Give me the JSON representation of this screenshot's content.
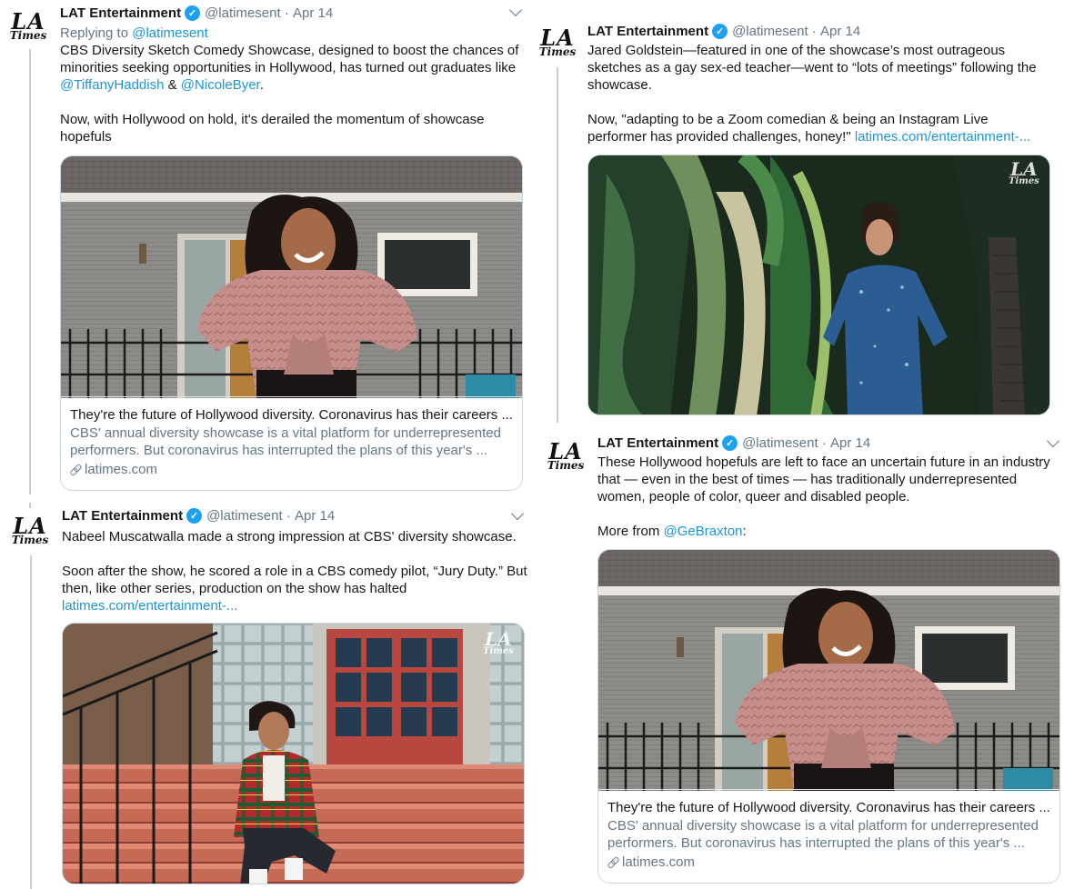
{
  "account": {
    "name": "LAT Entertainment",
    "handle": "@latimesent",
    "date": "Apr 14",
    "avatar_top": "LA",
    "avatar_bottom": "Times",
    "verified_icon": "verified-badge-icon",
    "brand_color": "#1da1f2"
  },
  "tweet1": {
    "replying_prefix": "Replying to ",
    "replying_handle": "@latimesent",
    "line1": "CBS Diversity Sketch Comedy Showcase, designed to boost the chances of",
    "line2": "minorities seeking opportunities in Hollywood, has turned out graduates like",
    "mention1": "@TiffanyHaddish",
    "amp": " & ",
    "mention2": "@NicoleByer",
    "dot": ".",
    "line4": "Now, with Hollywood on hold, it's derailed the momentum of showcase",
    "line5": "hopefuls",
    "card": {
      "title": "They're the future of Hollywood diversity. Coronavirus has their careers ...",
      "desc1": "CBS' annual diversity showcase is a vital platform for underrepresented",
      "desc2": "performers. But coronavirus has interrupted the plans of this year's ...",
      "domain": "latimes.com"
    }
  },
  "tweet2": {
    "line1": "Jared Goldstein—featured in one of the showcase’s most outrageous",
    "line2": "sketches as a gay sex-ed teacher—went to “lots of meetings” following the",
    "line3": "showcase.",
    "line4": "Now, \"adapting to be a Zoom comedian & being an Instagram Live",
    "line5a": "performer has provided challenges, honey!\" ",
    "line5link": "latimes.com/entertainment-..."
  },
  "tweet3": {
    "line1": "Nabeel Muscatwalla made a strong impression at CBS' diversity showcase.",
    "line2": "Soon after the show, he scored a role in a CBS comedy pilot, “Jury Duty.” But",
    "line3": "then, like other series, production on the show has halted",
    "link": "latimes.com/entertainment-..."
  },
  "tweet4": {
    "line1": "These Hollywood hopefuls are left to face an uncertain future in an industry",
    "line2": "that — even in the best of times — has traditionally underrepresented",
    "line3": "women, people of color, queer and disabled people.",
    "more_prefix": "More from ",
    "mention": "@GeBraxton",
    "colon": ":",
    "card": {
      "title": "They're the future of Hollywood diversity. Coronavirus has their careers ...",
      "desc1": "CBS' annual diversity showcase is a vital platform for underrepresented",
      "desc2": "performers. But coronavirus has interrupted the plans of this year's ...",
      "domain": "latimes.com"
    }
  },
  "colors": {
    "link": "#1b95e0",
    "meta": "#657786",
    "border": "#ccd6dd"
  }
}
